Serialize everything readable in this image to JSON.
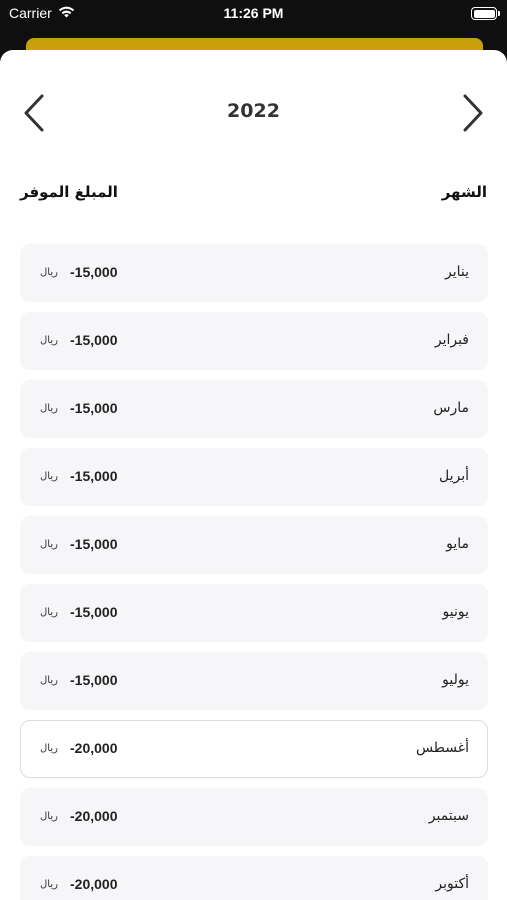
{
  "status": {
    "carrier": "Carrier",
    "time": "11:26 PM"
  },
  "header": {
    "year": "2022"
  },
  "columns": {
    "month": "الشهر",
    "saved": "المبلغ الموفر"
  },
  "months": [
    {
      "name": "يناير",
      "amount": "-15,000",
      "currency": "ريال"
    },
    {
      "name": "فبراير",
      "amount": "-15,000",
      "currency": "ريال"
    },
    {
      "name": "مارس",
      "amount": "-15,000",
      "currency": "ريال"
    },
    {
      "name": "أبريل",
      "amount": "-15,000",
      "currency": "ريال"
    },
    {
      "name": "مايو",
      "amount": "-15,000",
      "currency": "ريال"
    },
    {
      "name": "يونيو",
      "amount": "-15,000",
      "currency": "ريال"
    },
    {
      "name": "يوليو",
      "amount": "-15,000",
      "currency": "ريال"
    },
    {
      "name": "أغسطس",
      "amount": "-20,000",
      "currency": "ريال"
    },
    {
      "name": "سبتمبر",
      "amount": "-20,000",
      "currency": "ريال"
    },
    {
      "name": "أكتوبر",
      "amount": "-20,000",
      "currency": "ريال"
    }
  ],
  "selected_month": "أغسطس",
  "colors": {
    "accent": "#c9a00a",
    "row_bg": "#f6f6f8",
    "selected_border": "#dcdce0"
  },
  "icons": {
    "prev": "chevron-left-icon",
    "next": "chevron-right-icon",
    "wifi": "wifi-icon",
    "battery": "battery-icon"
  }
}
